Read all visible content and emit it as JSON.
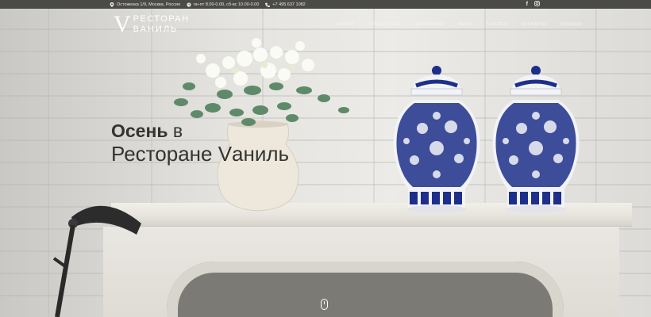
{
  "topbar": {
    "address": "Остоженка 1/9, Москва, Россия",
    "hours": "пн-пт 8.00-0.00, сб-вс 10.00-0.00",
    "phone": "+7 495 637 1082",
    "social": [
      {
        "icon": "facebook-icon",
        "label": "f"
      },
      {
        "icon": "instagram-icon",
        "label": ""
      }
    ]
  },
  "logo": {
    "mark": "V",
    "line1": "РЕСТОРАН",
    "line2": "ВАНИЛЬ"
  },
  "nav": [
    "НАВЕРХ",
    "О РЕСТОРАНЕ",
    "ШЕФ-ПОВАР",
    "МЕНЮ",
    "ГАЛЕРЕЯ",
    "КОНТАКТЫ",
    "БРОНЬКА"
  ],
  "hero": {
    "line1_bold": "Осень",
    "line1_rest": " в",
    "line2": "Ресторане Vаниль"
  },
  "colors": {
    "topbar": "#4a4a48",
    "headline": "#333331",
    "porcelain_blue": "#1d2f8a"
  }
}
